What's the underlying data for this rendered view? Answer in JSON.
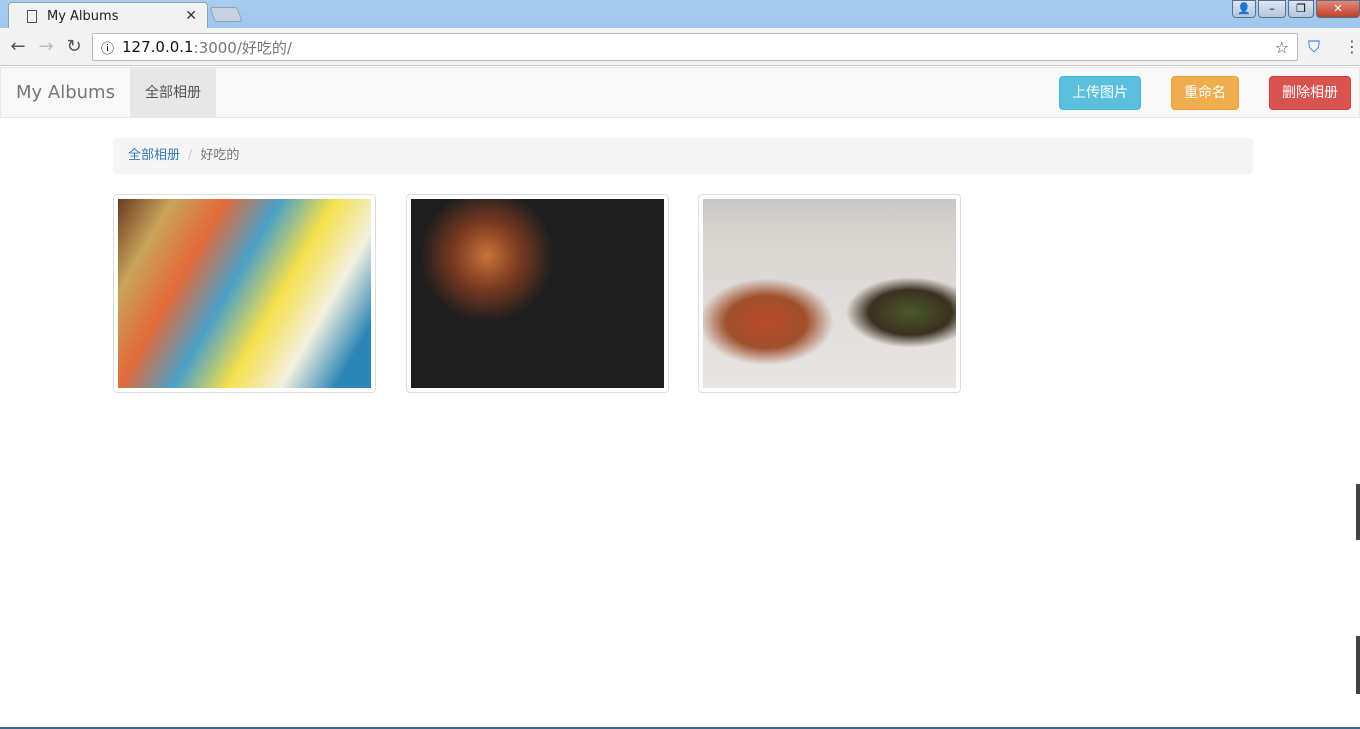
{
  "browser": {
    "tab_title": "My Albums",
    "url_host": "127.0.0.1",
    "url_path": ":3000/好吃的/"
  },
  "navbar": {
    "brand": "My Albums",
    "link": "全部相册",
    "upload": "上传图片",
    "rename": "重命名",
    "delete": "删除相册"
  },
  "colors": {
    "upload": "#5bc0de",
    "rename": "#f0ad4e",
    "delete": "#d9534f",
    "link": "#337ab7"
  },
  "breadcrumb": {
    "root": "全部相册",
    "sep": "/",
    "current": "好吃的"
  },
  "photos": [
    {
      "icon": "snack-bags-photo"
    },
    {
      "icon": "ramen-dinner-photo"
    },
    {
      "icon": "home-dishes-photo"
    }
  ]
}
